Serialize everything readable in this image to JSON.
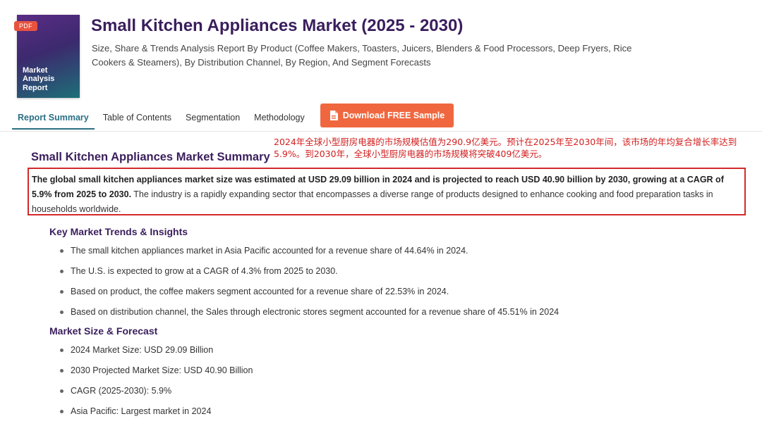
{
  "cover": {
    "badge": "PDF",
    "text": "Market\nAnalysis\nReport"
  },
  "header": {
    "title": "Small Kitchen Appliances Market (2025 - 2030)",
    "subtitle": "Size, Share & Trends Analysis Report By Product (Coffee Makers, Toasters, Juicers, Blenders & Food Processors, Deep Fryers, Rice Cookers & Steamers), By Distribution Channel, By Region, And Segment Forecasts"
  },
  "tabs": [
    {
      "label": "Report Summary",
      "active": true
    },
    {
      "label": "Table of Contents",
      "active": false
    },
    {
      "label": "Segmentation",
      "active": false
    },
    {
      "label": "Methodology",
      "active": false
    }
  ],
  "download_button": {
    "label": "Download FREE Sample",
    "icon": "pdf-file-icon"
  },
  "annotation": "2024年全球小型厨房电器的市场规模估值为290.9亿美元。预计在2025年至2030年间，该市场的年均复合增长率达到5.9%。到2030年，全球小型厨房电器的市场规模将突破409亿美元。",
  "summary": {
    "title": "Small Kitchen Appliances Market Summary",
    "bold_text": "The global small kitchen appliances market size was estimated at USD 29.09 billion in 2024 and is projected to reach USD 40.90 billion by 2030, growing at a CAGR of 5.9% from 2025 to 2030.",
    "rest_text": " The industry is a rapidly expanding sector that encompasses a diverse range of products designed to enhance cooking and food preparation tasks in households worldwide."
  },
  "key_trends": {
    "heading": "Key Market Trends & Insights",
    "items": [
      "The small kitchen appliances market in Asia Pacific accounted for a revenue share of 44.64% in 2024.",
      "The U.S. is expected to grow at a CAGR of 4.3% from 2025 to 2030.",
      "Based on product, the coffee makers segment accounted for a revenue share of 22.53% in 2024.",
      "Based on distribution channel, the Sales through electronic stores segment accounted for a revenue share of 45.51% in 2024"
    ]
  },
  "forecast": {
    "heading": "Market Size & Forecast",
    "items": [
      "2024 Market Size: USD 29.09 Billion",
      "2030 Projected Market Size: USD 40.90 Billion",
      "CAGR (2025-2030): 5.9%",
      "Asia Pacific: Largest market in 2024"
    ]
  },
  "colors": {
    "brand_purple": "#3a1e5c",
    "tab_active": "#2a6f83",
    "cta_orange": "#f0673f",
    "annotation_red": "#d21f1f"
  }
}
